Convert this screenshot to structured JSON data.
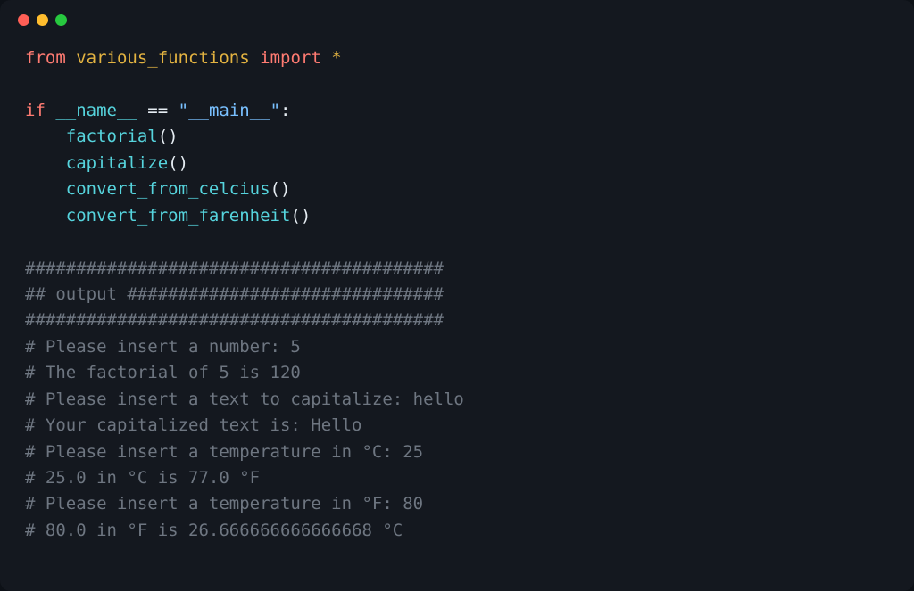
{
  "code": {
    "kw_from": "from",
    "module": "various_functions",
    "kw_import": "import",
    "star": "*",
    "kw_if": "if",
    "dunder_name": "__name__",
    "eq": " == ",
    "str_main": "\"__main__\"",
    "colon": ":",
    "fn1": "factorial",
    "fn2": "capitalize",
    "fn3": "convert_from_celcius",
    "fn4": "convert_from_farenheit",
    "parens": "()",
    "indent": "    "
  },
  "output": {
    "hr1": "#########################################",
    "title": "## output ###############################",
    "hr2": "#########################################",
    "l1": "# Please insert a number: 5",
    "l2": "# The factorial of 5 is 120",
    "l3": "# Please insert a text to capitalize: hello",
    "l4": "# Your capitalized text is: Hello",
    "l5": "# Please insert a temperature in °C: 25",
    "l6": "# 25.0 in °C is 77.0 °F",
    "l7": "# Please insert a temperature in °F: 80",
    "l8": "# 80.0 in °F is 26.666666666666668 °C"
  }
}
